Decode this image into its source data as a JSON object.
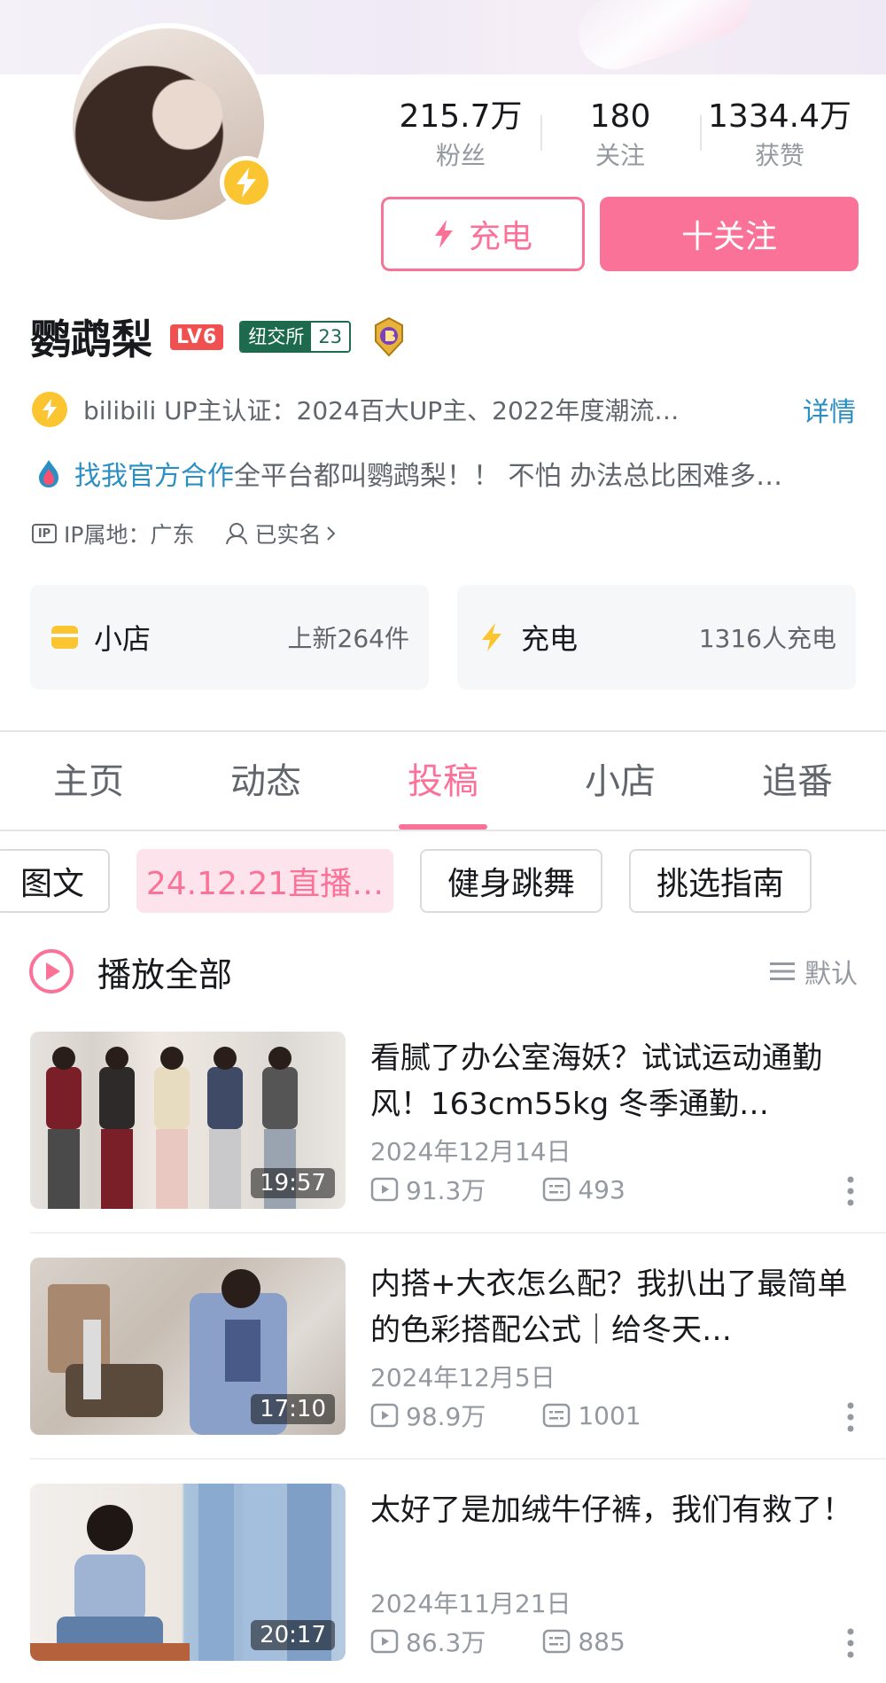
{
  "profile": {
    "username": "鹦鹉梨",
    "level": "LV6",
    "nyse_label": "纽交所",
    "nyse_number": "23",
    "stats": [
      {
        "value": "215.7万",
        "label": "粉丝"
      },
      {
        "value": "180",
        "label": "关注"
      },
      {
        "value": "1334.4万",
        "label": "获赞"
      }
    ],
    "charge_button": "充电",
    "follow_button": "十关注",
    "certification": "bilibili UP主认证：2024百大UP主、2022年度潮流…",
    "certification_more": "详情",
    "bio_link": "找我官方合作",
    "bio_text": "全平台都叫鹦鹉梨！！ 不怕 办法总比困难多…",
    "ip_location": "IP属地：广东",
    "verified_text": "已实名",
    "ip_icon_text": "IP"
  },
  "cards": {
    "shop": {
      "title": "小店",
      "subtitle": "上新264件"
    },
    "charge": {
      "title": "充电",
      "subtitle": "1316人充电"
    }
  },
  "tabs": [
    {
      "label": "主页",
      "active": false
    },
    {
      "label": "动态",
      "active": false
    },
    {
      "label": "投稿",
      "active": true
    },
    {
      "label": "小店",
      "active": false
    },
    {
      "label": "追番",
      "active": false
    }
  ],
  "chips": [
    {
      "label": "图文",
      "active": false
    },
    {
      "label": "24.12.21直播…",
      "active": true
    },
    {
      "label": "健身跳舞",
      "active": false
    },
    {
      "label": "挑选指南",
      "active": false
    }
  ],
  "playall": {
    "label": "播放全部",
    "sort_label": "默认"
  },
  "videos": [
    {
      "title": "看腻了办公室海妖？试试运动通勤风！163cm55kg 冬季通勤…",
      "date": "2024年12月14日",
      "views": "91.3万",
      "comments": "493",
      "duration": "19:57"
    },
    {
      "title": "内搭+大衣怎么配？我扒出了最简单的色彩搭配公式｜给冬天…",
      "date": "2024年12月5日",
      "views": "98.9万",
      "comments": "1001",
      "duration": "17:10"
    },
    {
      "title": "太好了是加绒牛仔裤，我们有救了！",
      "date": "2024年11月21日",
      "views": "86.3万",
      "comments": "885",
      "duration": "20:17"
    }
  ],
  "colors": {
    "accent": "#fb7299",
    "link": "#2b8fc3",
    "badge_yellow": "#fbc531",
    "nyse_green": "#1e6a4f"
  },
  "icons": {
    "avatar_badge": "lightning-icon",
    "sort": "list-icon",
    "views": "play-icon",
    "comments": "danmaku-icon",
    "more": "more-vertical-icon"
  }
}
